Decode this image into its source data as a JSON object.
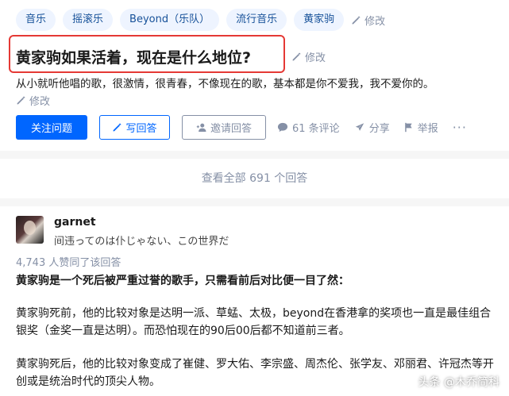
{
  "question": {
    "tags": [
      "音乐",
      "摇滚乐",
      "Beyond（乐队）",
      "流行音乐",
      "黄家驹"
    ],
    "tags_edit": "修改",
    "title": "黄家驹如果活着，现在是什么地位?",
    "title_edit": "修改",
    "description": "从小就听他唱的歌，很激情，很青春，不像现在的歌，基本都是你不爱我，我不爱你的。",
    "description_edit": "修改",
    "actions": {
      "follow": "关注问题",
      "write_answer": "写回答",
      "invite": "邀请回答",
      "comments": "61 条评论",
      "share": "分享",
      "report": "举报",
      "more": "···"
    }
  },
  "view_all": "查看全部 691 个回答",
  "answer": {
    "author": "garnet",
    "bio": "间违ってのは仆じゃない、この世界だ",
    "votes": "4,743 人赞同了该回答",
    "paragraphs": [
      "黄家驹是一个死后被严重过誉的歌手，只需看前后对比便一目了然：",
      "黄家驹死前，他的比较对象是达明一派、草蜢、太极，beyond在香港拿的奖项也一直是最佳组合银奖（金奖一直是达明）。而恐怕现在的90后00后都不知道前三者。",
      "黄家驹死后，他的比较对象变成了崔健、罗大佑、李宗盛、周杰伦、张学友、邓丽君、许冠杰等开创或是统治时代的顶尖人物。"
    ]
  },
  "watermark": "头条 @木乔简科",
  "colors": {
    "accent": "#0066ff",
    "tag_bg": "#eef4ff",
    "tag_text": "#175199",
    "muted": "#8590a6",
    "highlight_border": "#e53935"
  }
}
